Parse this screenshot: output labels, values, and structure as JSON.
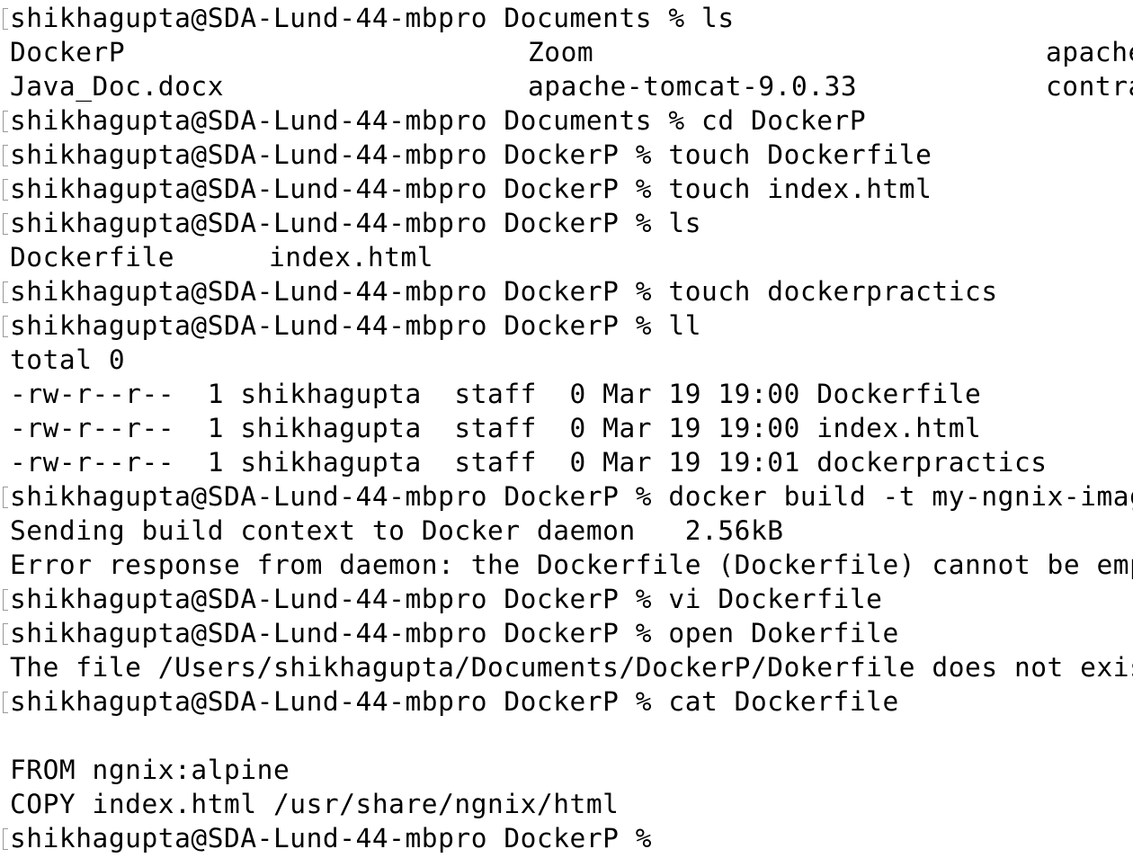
{
  "terminal": {
    "prompt": "shikhagupta@SDA-Lund-44-mbpro",
    "lines": [
      {
        "kind": "prompt",
        "cwd": "Documents",
        "cmd": "ls"
      },
      {
        "kind": "columns",
        "cols": [
          "DockerP",
          "Zoom",
          "apache"
        ]
      },
      {
        "kind": "columns",
        "cols": [
          "Java_Doc.docx",
          "apache-tomcat-9.0.33",
          "contra"
        ]
      },
      {
        "kind": "prompt",
        "cwd": "Documents",
        "cmd": "cd DockerP"
      },
      {
        "kind": "prompt",
        "cwd": "DockerP",
        "cmd": "touch Dockerfile"
      },
      {
        "kind": "prompt",
        "cwd": "DockerP",
        "cmd": "touch index.html"
      },
      {
        "kind": "prompt",
        "cwd": "DockerP",
        "cmd": "ls"
      },
      {
        "kind": "columns2",
        "cols": [
          "Dockerfile",
          "index.html"
        ]
      },
      {
        "kind": "prompt",
        "cwd": "DockerP",
        "cmd": "touch dockerpractics"
      },
      {
        "kind": "prompt",
        "cwd": "DockerP",
        "cmd": "ll"
      },
      {
        "kind": "output",
        "text": "total 0"
      },
      {
        "kind": "output",
        "text": "-rw-r--r--  1 shikhagupta  staff  0 Mar 19 19:00 Dockerfile"
      },
      {
        "kind": "output",
        "text": "-rw-r--r--  1 shikhagupta  staff  0 Mar 19 19:00 index.html"
      },
      {
        "kind": "output",
        "text": "-rw-r--r--  1 shikhagupta  staff  0 Mar 19 19:01 dockerpractics"
      },
      {
        "kind": "prompt",
        "cwd": "DockerP",
        "cmd": "docker build -t my-ngnix-image"
      },
      {
        "kind": "output",
        "text": "Sending build context to Docker daemon   2.56kB"
      },
      {
        "kind": "output",
        "text": "Error response from daemon: the Dockerfile (Dockerfile) cannot be empt"
      },
      {
        "kind": "prompt",
        "cwd": "DockerP",
        "cmd": "vi Dockerfile"
      },
      {
        "kind": "prompt",
        "cwd": "DockerP",
        "cmd": "open Dokerfile"
      },
      {
        "kind": "output",
        "text": "The file /Users/shikhagupta/Documents/DockerP/Dokerfile does not exist"
      },
      {
        "kind": "prompt",
        "cwd": "DockerP",
        "cmd": "cat Dockerfile"
      },
      {
        "kind": "output",
        "text": ""
      },
      {
        "kind": "output",
        "text": "FROM ngnix:alpine"
      },
      {
        "kind": "output",
        "text": "COPY index.html /usr/share/ngnix/html"
      },
      {
        "kind": "prompt",
        "cwd": "DockerP",
        "cmd": ""
      }
    ]
  }
}
